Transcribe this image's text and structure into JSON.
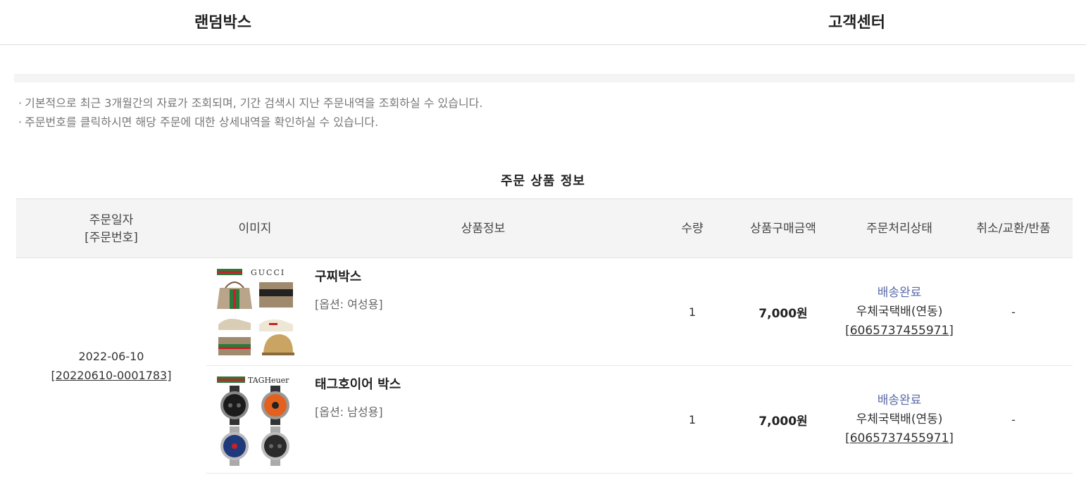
{
  "nav": {
    "random_box": "랜덤박스",
    "customer_center": "고객센터"
  },
  "notice": [
    "기본적으로 최근 3개월간의 자료가 조회되며, 기간 검색시 지난 주문내역을 조회하실 수 있습니다.",
    "주문번호를 클릭하시면 해당 주문에 대한 상세내역을 확인하실 수 있습니다."
  ],
  "section_title": "주문 상품 정보",
  "table": {
    "headers": {
      "date_line1": "주문일자",
      "date_line2": "[주문번호]",
      "image": "이미지",
      "product_info": "상품정보",
      "quantity": "수량",
      "price": "상품구매금액",
      "status": "주문처리상태",
      "cancel": "취소/교환/반품"
    },
    "order": {
      "date": "2022-06-10",
      "order_number": "[20220610-0001783]"
    },
    "rows": [
      {
        "thumbnail_text": "GUCCI",
        "name": "구찌박스",
        "option": "[옵션: 여성용]",
        "quantity": "1",
        "price": "7,000원",
        "status": "배송완료",
        "carrier": "우체국택배(연동)",
        "tracking": "[6065737455971]",
        "cancel": "-"
      },
      {
        "thumbnail_text": "TAGHeuer",
        "name": "태그호이어 박스",
        "option": "[옵션: 남성용]",
        "quantity": "1",
        "price": "7,000원",
        "status": "배송완료",
        "carrier": "우체국택배(연동)",
        "tracking": "[6065737455971]",
        "cancel": "-"
      }
    ]
  },
  "colors": {
    "status_link": "#5a6aa8",
    "header_bg": "#f4f4f4"
  }
}
